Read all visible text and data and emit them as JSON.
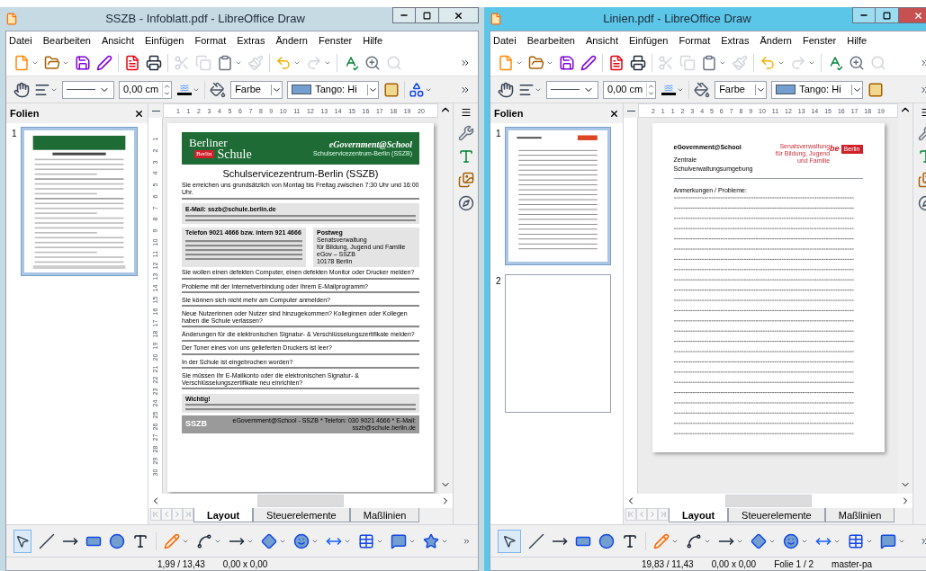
{
  "windows": [
    {
      "title": "SSZB - Infoblatt.pdf - LibreOffice Draw",
      "active": false,
      "menu": [
        "Datei",
        "Bearbeiten",
        "Ansicht",
        "Einfügen",
        "Format",
        "Extras",
        "Ändern",
        "Fenster",
        "Hilfe"
      ],
      "line_width": "0,00 cm",
      "fill_type": "Farbe",
      "fill_color": "Tango: Hi",
      "panel_title": "Folien",
      "slides": [
        {
          "number": "1",
          "selected": true,
          "kind": "infoblatt"
        }
      ],
      "hruler": [
        "1",
        "1",
        "2",
        "3",
        "4",
        "5",
        "6",
        "7",
        "8",
        "9",
        "10",
        "11",
        "12",
        "13",
        "14",
        "15",
        "16",
        "17",
        "18",
        "19",
        "20"
      ],
      "vruler": [
        "1",
        "2",
        "3",
        "4",
        "5",
        "6",
        "7",
        "8",
        "9",
        "10",
        "11",
        "12",
        "13",
        "14",
        "15",
        "16",
        "17",
        "18",
        "19",
        "20",
        "21",
        "22",
        "23",
        "24",
        "25",
        "26",
        "27",
        "28",
        "29",
        "30"
      ],
      "document": {
        "kind": "infoblatt",
        "brand_top": "Berliner",
        "brand_bottom": "Schule",
        "badge": "Berlin",
        "egov": "eGovernment@School",
        "egov_sub": "Schulservicezentrum-Berlin (SSZB)",
        "title": "Schulservicezentrum-Berlin (SSZB)",
        "intro": "Sie erreichen uns grundsätzlich von Montag bis Freitag zwischen 7:30 Uhr und 16:00 Uhr.",
        "email_heading": "E-Mail: sszb@schule.berlin.de",
        "phone_heading": "Telefon 9021 4666 bzw. intern 921 4666",
        "post_heading": "Postweg",
        "post_lines": [
          "Senatsverwaltung",
          "für Bildung, Jugend und Familie",
          "eGov – SSZB",
          "10178 Berlin"
        ],
        "sections": [
          {
            "heading": "Sie wollen einen defekten Computer, einen defekten Monitor oder Drucker melden?"
          },
          {
            "heading": "Probleme mit der Internetverbindung oder Ihrem E-Mailprogramm?"
          },
          {
            "heading": "Sie können sich nicht mehr am Computer anmelden?"
          },
          {
            "heading": "Neue Nutzerinnen oder Nutzer sind hinzugekommen? Kolleginnen oder Kollegen haben die Schule verlassen?"
          },
          {
            "heading": "Änderungen für die elektronischen Signatur- & Verschlüsselungszertifikate melden?"
          },
          {
            "heading": "Der Toner eines von uns gelieferten Druckers ist leer?"
          },
          {
            "heading": "In der Schule ist eingebrochen worden?"
          },
          {
            "heading": "Sie müssen Ihr E-Mailkonto oder die elektronischen Signatur- & Verschlüsselungszertifikate neu einrichten?"
          }
        ],
        "important": "Wichtig!",
        "footer": "eGovernment@School - SSZB * Telefon: 030 9021 4666 * E-Mail: sszb@schule.berlin.de",
        "watermark": "SSZB"
      },
      "tabs": [
        {
          "label": "Layout",
          "selected": true
        },
        {
          "label": "Steuerelemente",
          "selected": false
        },
        {
          "label": "Maßlinien",
          "selected": false
        }
      ],
      "pointer_active": true,
      "status": [
        "1,99 / 13,43",
        "0,00 x 0,00"
      ]
    },
    {
      "title": "Linien.pdf - LibreOffice Draw",
      "active": true,
      "menu": [
        "Datei",
        "Bearbeiten",
        "Ansicht",
        "Einfügen",
        "Format",
        "Extras",
        "Ändern",
        "Fenster",
        "Hilfe"
      ],
      "line_width": "0,00 cm",
      "fill_type": "Farbe",
      "fill_color": "Tango: Hi",
      "panel_title": "Folien",
      "slides": [
        {
          "number": "1",
          "selected": true,
          "kind": "lines"
        },
        {
          "number": "2",
          "selected": false,
          "kind": "blank"
        }
      ],
      "hruler": [
        "2",
        "1",
        "1",
        "2",
        "3",
        "4",
        "5",
        "6",
        "7",
        "8",
        "9",
        "10",
        "11",
        "12",
        "13",
        "14",
        "15",
        "16",
        "17",
        "18",
        "19"
      ],
      "document": {
        "kind": "lines",
        "egov": "eGovernment@School",
        "authority": "Senatsverwaltung für Bildung, Jugend und Familie",
        "logo": "be",
        "badge": "Berlin",
        "subtitle": "Zentrale Schulverwaltungsumgebung",
        "notes_label": "Anmerkungen / Probleme:"
      },
      "tabs": [
        {
          "label": "Layout",
          "selected": true
        },
        {
          "label": "Steuerelemente",
          "selected": false
        },
        {
          "label": "Maßlinien",
          "selected": false
        }
      ],
      "pointer_active": true,
      "status": [
        "19,83 / 11,43",
        "0,00 x 0,00",
        "Folie 1 / 2",
        "master-pa"
      ]
    }
  ]
}
